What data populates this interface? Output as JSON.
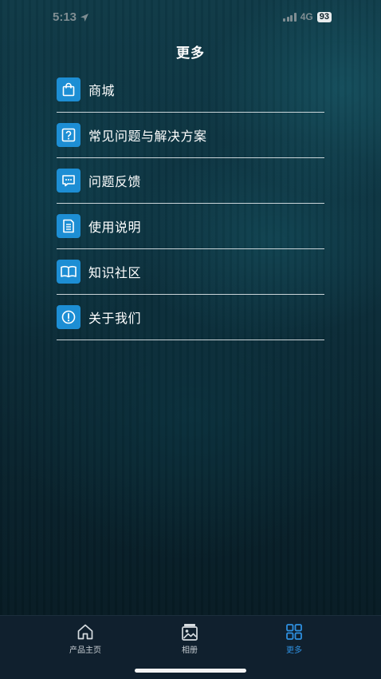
{
  "status": {
    "time": "5:13",
    "network": "4G",
    "battery": "93"
  },
  "header": {
    "title": "更多"
  },
  "menu": {
    "items": [
      {
        "label": "商城",
        "icon": "shopping-bag-icon"
      },
      {
        "label": "常见问题与解决方案",
        "icon": "question-icon"
      },
      {
        "label": "问题反馈",
        "icon": "chat-feedback-icon"
      },
      {
        "label": "使用说明",
        "icon": "document-icon"
      },
      {
        "label": "知识社区",
        "icon": "book-icon"
      },
      {
        "label": "关于我们",
        "icon": "info-icon"
      }
    ]
  },
  "tabbar": {
    "tabs": [
      {
        "label": "产品主页",
        "icon": "home-icon",
        "active": false
      },
      {
        "label": "相册",
        "icon": "album-icon",
        "active": false
      },
      {
        "label": "更多",
        "icon": "grid-icon",
        "active": true
      }
    ]
  },
  "colors": {
    "accent": "#1d8ed4",
    "active_tab": "#2e90e0",
    "tabbar_bg": "#10202e"
  }
}
